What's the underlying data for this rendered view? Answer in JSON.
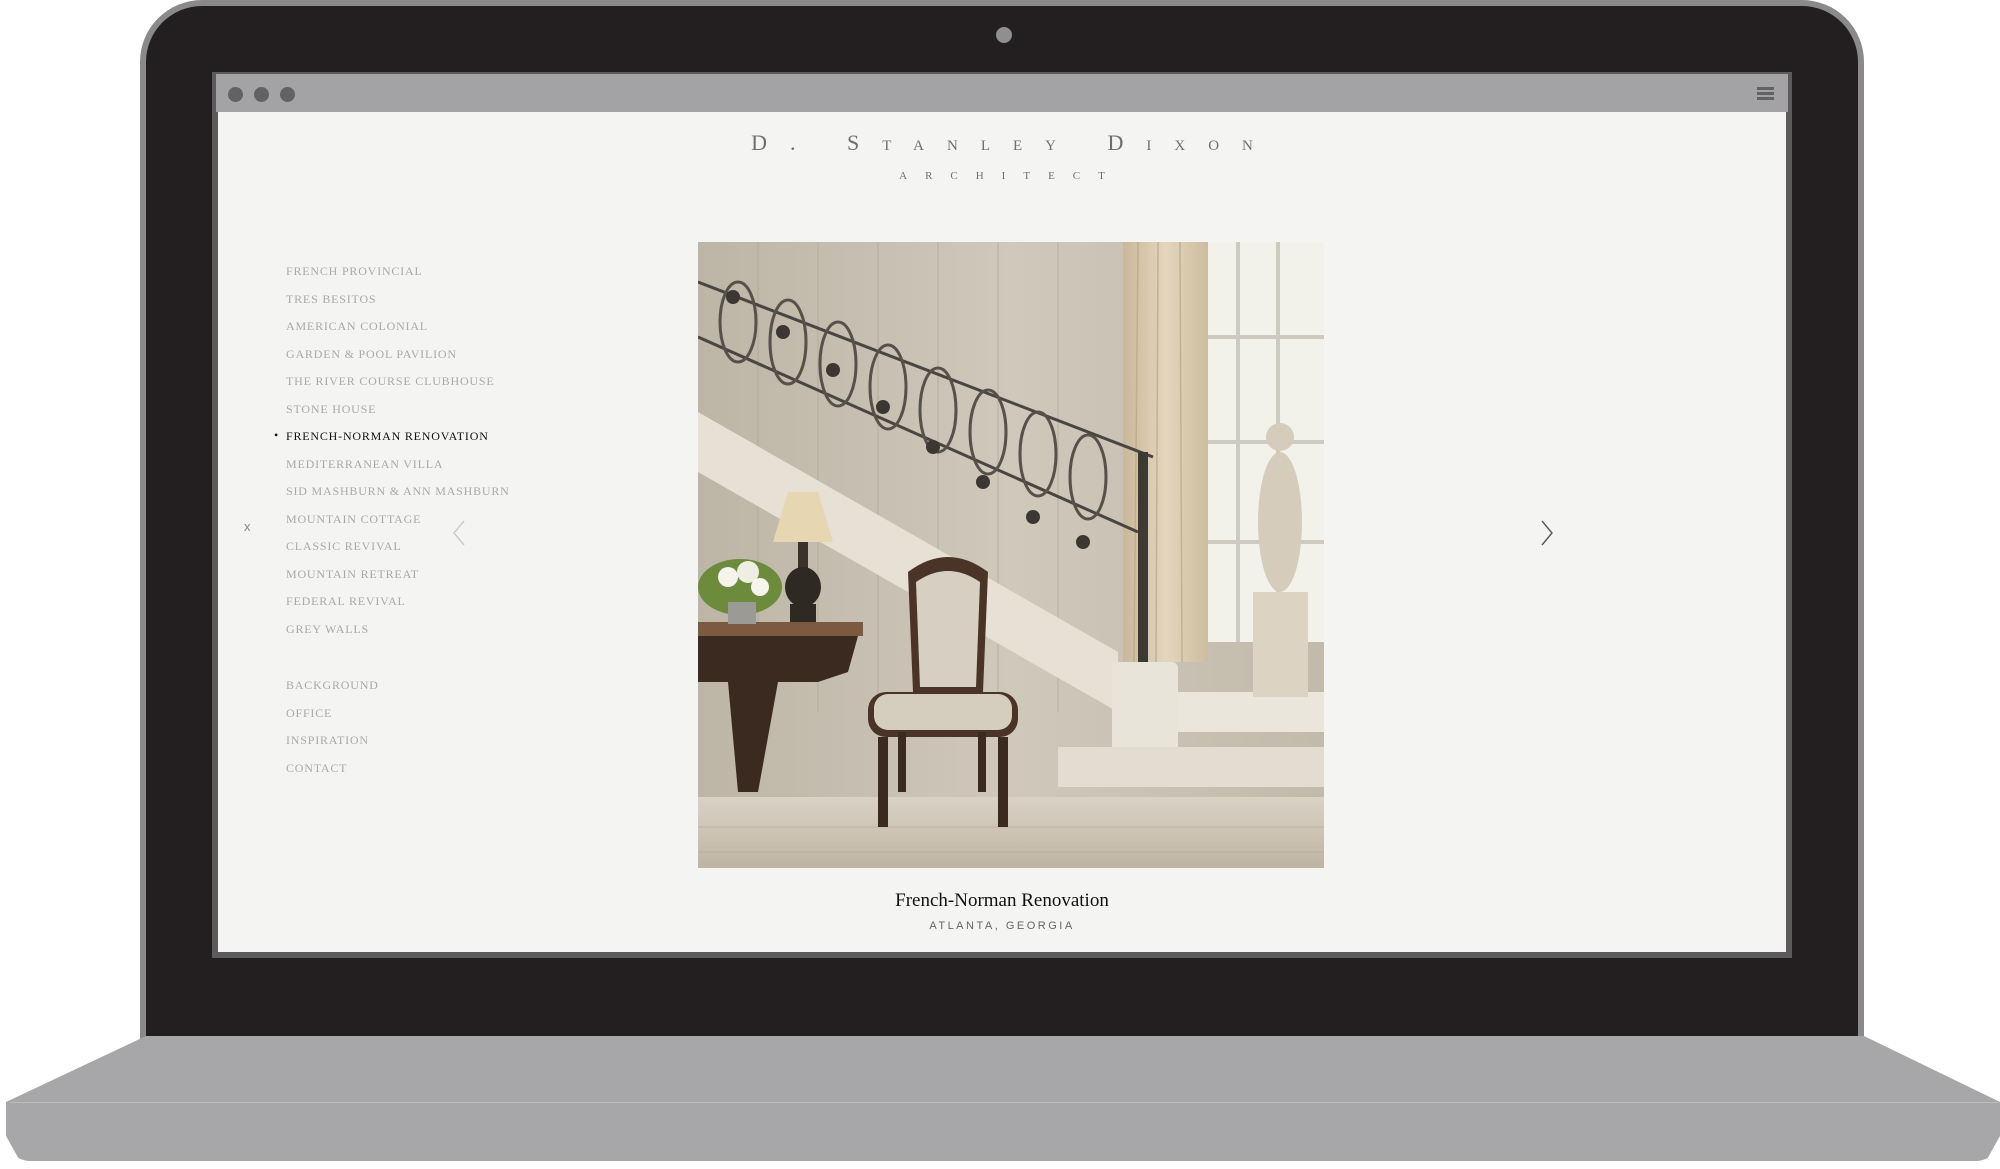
{
  "brand": {
    "name": "D. Stanley Dixon",
    "subtitle": "ARCHITECT"
  },
  "nav": {
    "projects": [
      {
        "label": "French Provincial",
        "active": false
      },
      {
        "label": "Tres Besitos",
        "active": false
      },
      {
        "label": "American Colonial",
        "active": false
      },
      {
        "label": "Garden & Pool Pavilion",
        "active": false
      },
      {
        "label": "The River Course Clubhouse",
        "active": false
      },
      {
        "label": "Stone House",
        "active": false
      },
      {
        "label": "French-Norman Renovation",
        "active": true
      },
      {
        "label": "Mediterranean Villa",
        "active": false
      },
      {
        "label": "Sid Mashburn & Ann Mashburn",
        "active": false
      },
      {
        "label": "Mountain Cottage",
        "active": false
      },
      {
        "label": "Classic Revival",
        "active": false
      },
      {
        "label": "Mountain Retreat",
        "active": false
      },
      {
        "label": "Federal Revival",
        "active": false
      },
      {
        "label": "Grey Walls",
        "active": false
      }
    ],
    "pages": [
      "Background",
      "Office",
      "Inspiration",
      "Contact"
    ],
    "close_label": "x"
  },
  "caption": {
    "title": "French-Norman Renovation",
    "location": "ATLANTA, GEORGIA"
  },
  "icons": {
    "prev": "chevron-left-icon",
    "next": "chevron-right-icon",
    "menu": "hamburger-menu-icon"
  },
  "colors": {
    "page_bg": "#f4f4f2",
    "nav_text": "#a9a9a6",
    "nav_active": "#111111",
    "laptop_bezel": "#231f20",
    "laptop_body": "#a7a7a9"
  }
}
